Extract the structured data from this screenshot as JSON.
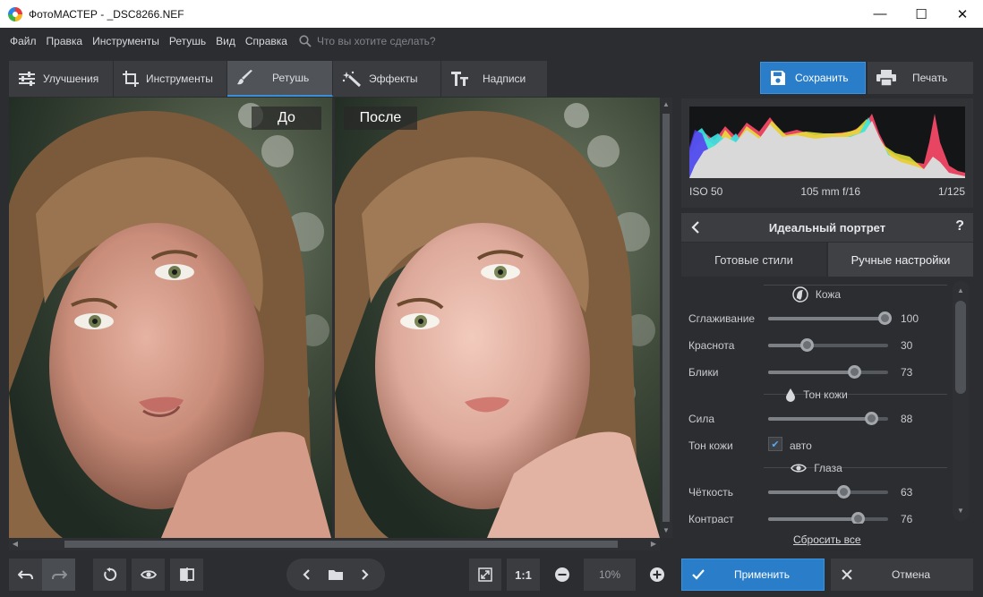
{
  "window": {
    "title": "ФотоМАСТЕР - _DSC8266.NEF",
    "minimize_glyph": "—",
    "maximize_glyph": "☐",
    "close_glyph": "✕"
  },
  "menu": {
    "items": [
      "Файл",
      "Правка",
      "Инструменты",
      "Ретушь",
      "Вид",
      "Справка"
    ],
    "search_placeholder": "Что вы хотите сделать?"
  },
  "tabs": [
    {
      "label": "Улучшения",
      "icon": "sliders-icon"
    },
    {
      "label": "Инструменты",
      "icon": "crop-icon"
    },
    {
      "label": "Ретушь",
      "icon": "brush-icon",
      "active": true
    },
    {
      "label": "Эффекты",
      "icon": "magic-wand-icon"
    },
    {
      "label": "Надписи",
      "icon": "text-icon"
    }
  ],
  "actions": {
    "save_label": "Сохранить",
    "print_label": "Печать"
  },
  "viewer": {
    "before_label": "До",
    "after_label": "После"
  },
  "histogram": {
    "iso": "ISO 50",
    "lens": "105 mm f/16",
    "shutter": "1/125"
  },
  "panel": {
    "title": "Идеальный портрет",
    "help": "?",
    "subtabs": [
      "Готовые стили",
      "Ручные настройки"
    ],
    "active_subtab": 1,
    "sections": {
      "skin": "Кожа",
      "skin_tone": "Тон кожи",
      "eyes": "Глаза"
    },
    "sliders": {
      "smoothing": {
        "label": "Сглаживание",
        "value": 100
      },
      "redness": {
        "label": "Краснота",
        "value": 30
      },
      "highlights": {
        "label": "Блики",
        "value": 73
      },
      "strength": {
        "label": "Сила",
        "value": 88
      },
      "clarity": {
        "label": "Чёткость",
        "value": 63
      },
      "contrast": {
        "label": "Контраст",
        "value": 76
      }
    },
    "tone_auto": {
      "label": "Тон кожи",
      "checkbox_label": "авто",
      "checked": true
    },
    "reset_label": "Сбросить все"
  },
  "bottom": {
    "one_to_one": "1:1",
    "zoom_value": "10%",
    "apply_label": "Применить",
    "cancel_label": "Отмена"
  },
  "colors": {
    "accent": "#2a7ec9",
    "background": "#2b2d30",
    "panel": "#3a3c40"
  }
}
